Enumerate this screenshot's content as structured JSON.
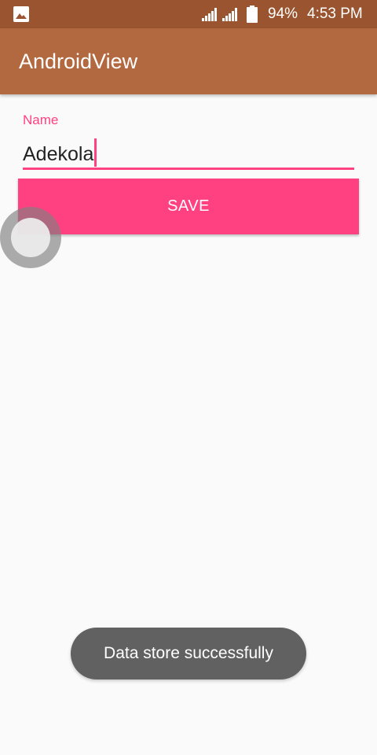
{
  "status_bar": {
    "battery": "94%",
    "time": "4:53 PM",
    "icons": [
      "gallery-icon",
      "signal-icon",
      "signal-icon",
      "battery-icon"
    ]
  },
  "app_bar": {
    "title": "AndroidView"
  },
  "form": {
    "name_label": "Name",
    "name_value": "Adekola",
    "save_label": "SAVE"
  },
  "toast": {
    "message": "Data store successfully"
  },
  "colors": {
    "status_bar": "#9a5530",
    "app_bar": "#b3693f",
    "accent": "#ff4081",
    "toast": "#616161",
    "background": "#fafafa"
  }
}
